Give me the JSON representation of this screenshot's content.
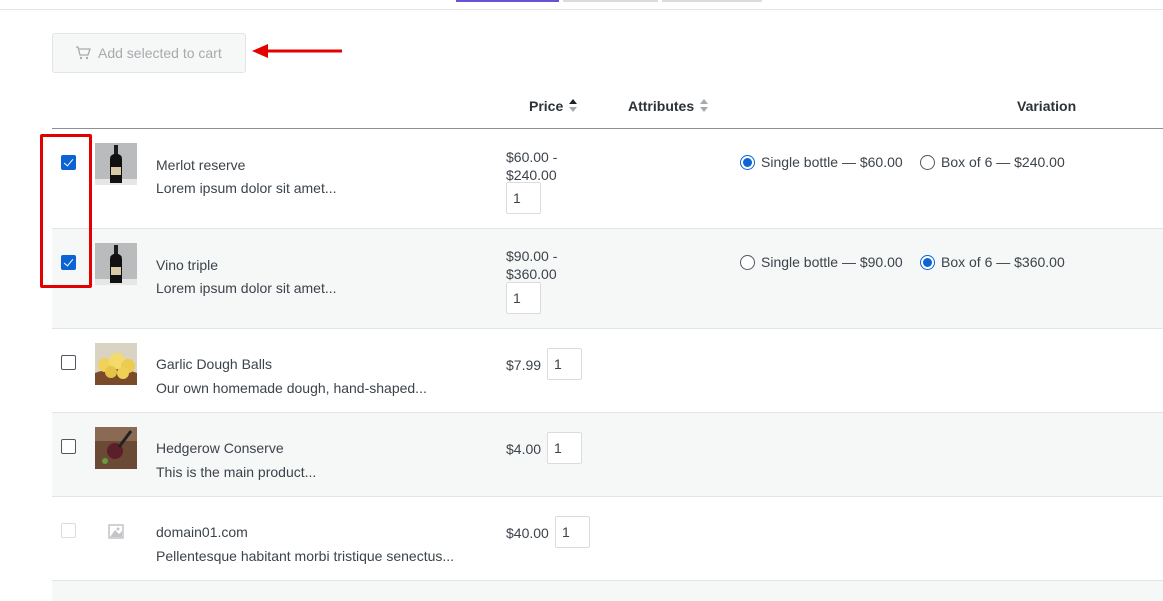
{
  "toolbar": {
    "add_selected_label": "Add selected to cart"
  },
  "table": {
    "headers": {
      "price": "Price",
      "attributes": "Attributes",
      "variation": "Variation"
    },
    "rows": [
      {
        "checked": true,
        "name": "Merlot reserve",
        "description": "Lorem ipsum dolor sit amet...",
        "price_line1": "$60.00 -",
        "price_line2": "$240.00",
        "qty": "1",
        "variations": [
          {
            "label": "Single bottle — $60.00",
            "selected": true
          },
          {
            "label": "Box of 6 — $240.00",
            "selected": false
          }
        ]
      },
      {
        "checked": true,
        "name": "Vino triple",
        "description": "Lorem ipsum dolor sit amet...",
        "price_line1": "$90.00 -",
        "price_line2": "$360.00",
        "qty": "1",
        "variations": [
          {
            "label": "Single bottle — $90.00",
            "selected": false
          },
          {
            "label": "Box of 6 — $360.00",
            "selected": true
          }
        ]
      },
      {
        "checked": false,
        "name": "Garlic Dough Balls",
        "description": "Our own homemade dough, hand-shaped...",
        "price": "$7.99",
        "qty": "1"
      },
      {
        "checked": false,
        "name": "Hedgerow Conserve",
        "description": "This is the main product...",
        "price": "$4.00",
        "qty": "1"
      },
      {
        "checked": false,
        "disabled": true,
        "name": "domain01.com",
        "description": "Pellentesque habitant morbi tristique senectus...",
        "price": "$40.00",
        "qty": "1"
      }
    ]
  },
  "icons": {
    "cart": "cart-icon",
    "arrow": "red-arrow-annotation",
    "sort": "sort-arrows-icon",
    "placeholder": "image-placeholder-icon"
  },
  "colors": {
    "accent": "#0b63d4",
    "tab_active": "#6b51d6",
    "annotation": "#e30000",
    "row_alt": "#f6f7f7"
  }
}
